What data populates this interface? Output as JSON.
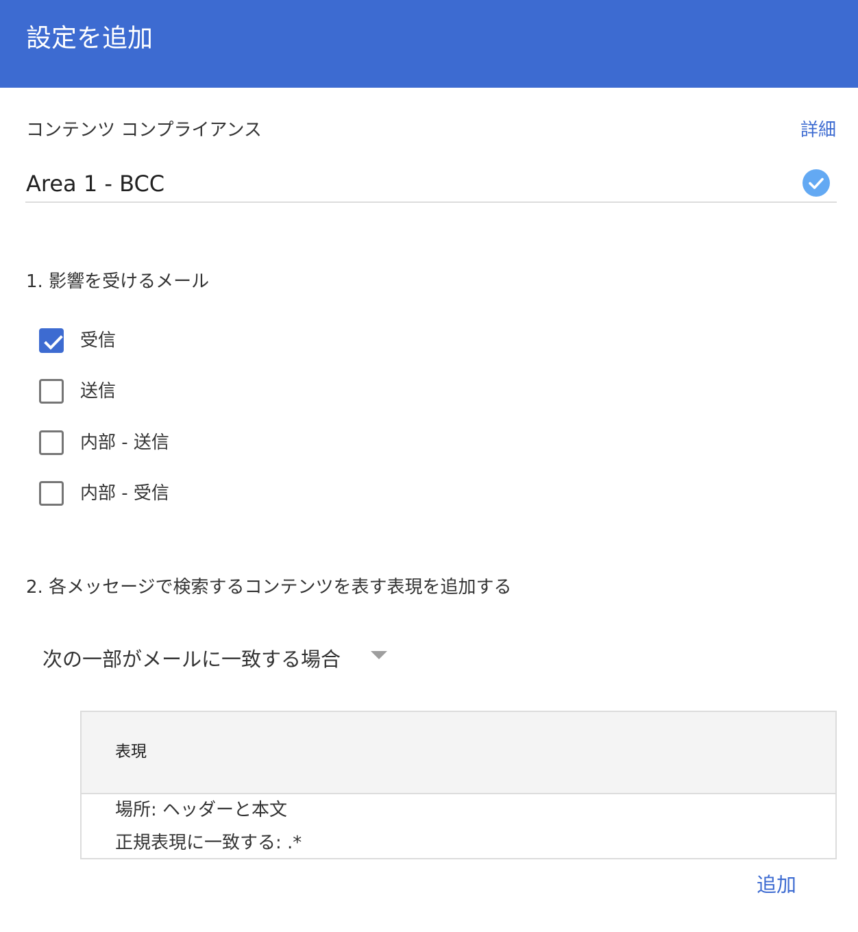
{
  "header": {
    "title": "設定を追加"
  },
  "setting": {
    "type_label": "コンテンツ コンプライアンス",
    "details_link": "詳細",
    "name": "Area 1 - BCC",
    "name_valid_icon": "check-circle-icon"
  },
  "step1": {
    "title": "1. 影響を受けるメール",
    "options": [
      {
        "label": "受信",
        "checked": true
      },
      {
        "label": "送信",
        "checked": false
      },
      {
        "label": "内部 - 送信",
        "checked": false
      },
      {
        "label": "内部 - 受信",
        "checked": false
      }
    ]
  },
  "step2": {
    "title": "2. 各メッセージで検索するコンテンツを表す表現を追加する",
    "match_select": {
      "selected": "次の一部がメールに一致する場合"
    },
    "expressions_table": {
      "header": "表現",
      "rows": [
        {
          "location": "場所: ヘッダーと本文",
          "rule": "正規表現に一致する: .*"
        }
      ]
    },
    "add_label": "追加"
  },
  "colors": {
    "header_bg": "#3d6bd1",
    "accent": "#3d6bd1",
    "valid_icon": "#63a9f3"
  }
}
